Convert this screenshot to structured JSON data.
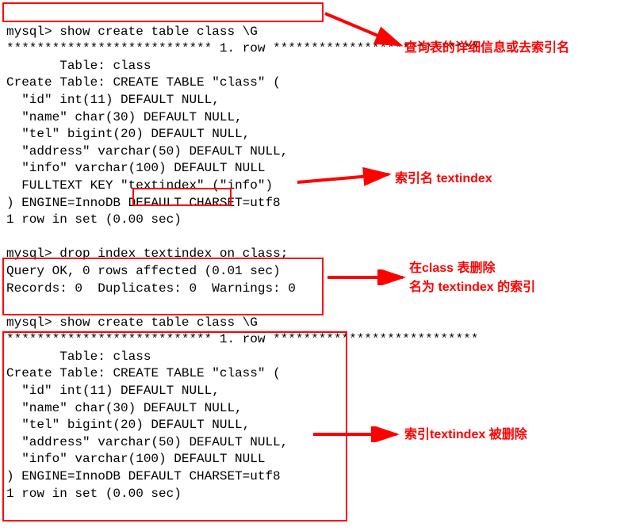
{
  "block1": {
    "prompt": "mysql>",
    "cmd": "show create table class \\G",
    "row_sep_left": "***************************",
    "row_label": "1. row",
    "row_sep_right": "***************************",
    "table_label": "Table:",
    "table_name": "class",
    "create_label": "Create Table:",
    "create_stmt": "CREATE TABLE \"class\" (",
    "col_id": "\"id\" int(11) DEFAULT NULL,",
    "col_name": "\"name\" char(30) DEFAULT NULL,",
    "col_tel": "\"tel\" bigint(20) DEFAULT NULL,",
    "col_address": "\"address\" varchar(50) DEFAULT NULL,",
    "col_info": "\"info\" varchar(100) DEFAULT NULL",
    "fulltext_prefix": "FULLTEXT KEY",
    "fulltext_key": "\"textindex\"",
    "fulltext_suffix": "(\"info\")",
    "engine": ") ENGINE=InnoDB DEFAULT CHARSET=utf8",
    "footer": "1 row in set (0.00 sec)"
  },
  "block2": {
    "prompt": "mysql>",
    "cmd": "drop index textindex on class;",
    "result1": "Query OK, 0 rows affected (0.01 sec)",
    "result2": "Records: 0  Duplicates: 0  Warnings: 0"
  },
  "block3": {
    "prompt": "mysql>",
    "cmd": "show create table class \\G",
    "row_sep_left": "***************************",
    "row_label": "1. row",
    "row_sep_right": "***************************",
    "table_label": "Table:",
    "table_name": "class",
    "create_label": "Create Table:",
    "create_stmt": "CREATE TABLE \"class\" (",
    "col_id": "\"id\" int(11) DEFAULT NULL,",
    "col_name": "\"name\" char(30) DEFAULT NULL,",
    "col_tel": "\"tel\" bigint(20) DEFAULT NULL,",
    "col_address": "\"address\" varchar(50) DEFAULT NULL,",
    "col_info": "\"info\" varchar(100) DEFAULT NULL",
    "engine": ") ENGINE=InnoDB DEFAULT CHARSET=utf8",
    "footer": "1 row in set (0.00 sec)"
  },
  "annotations": {
    "a1": "查询表的详细信息或去索引名",
    "a2": "索引名 textindex",
    "a3_line1": "在class 表删除",
    "a3_line2": "名为 textindex 的索引",
    "a4": "索引textindex 被删除"
  }
}
